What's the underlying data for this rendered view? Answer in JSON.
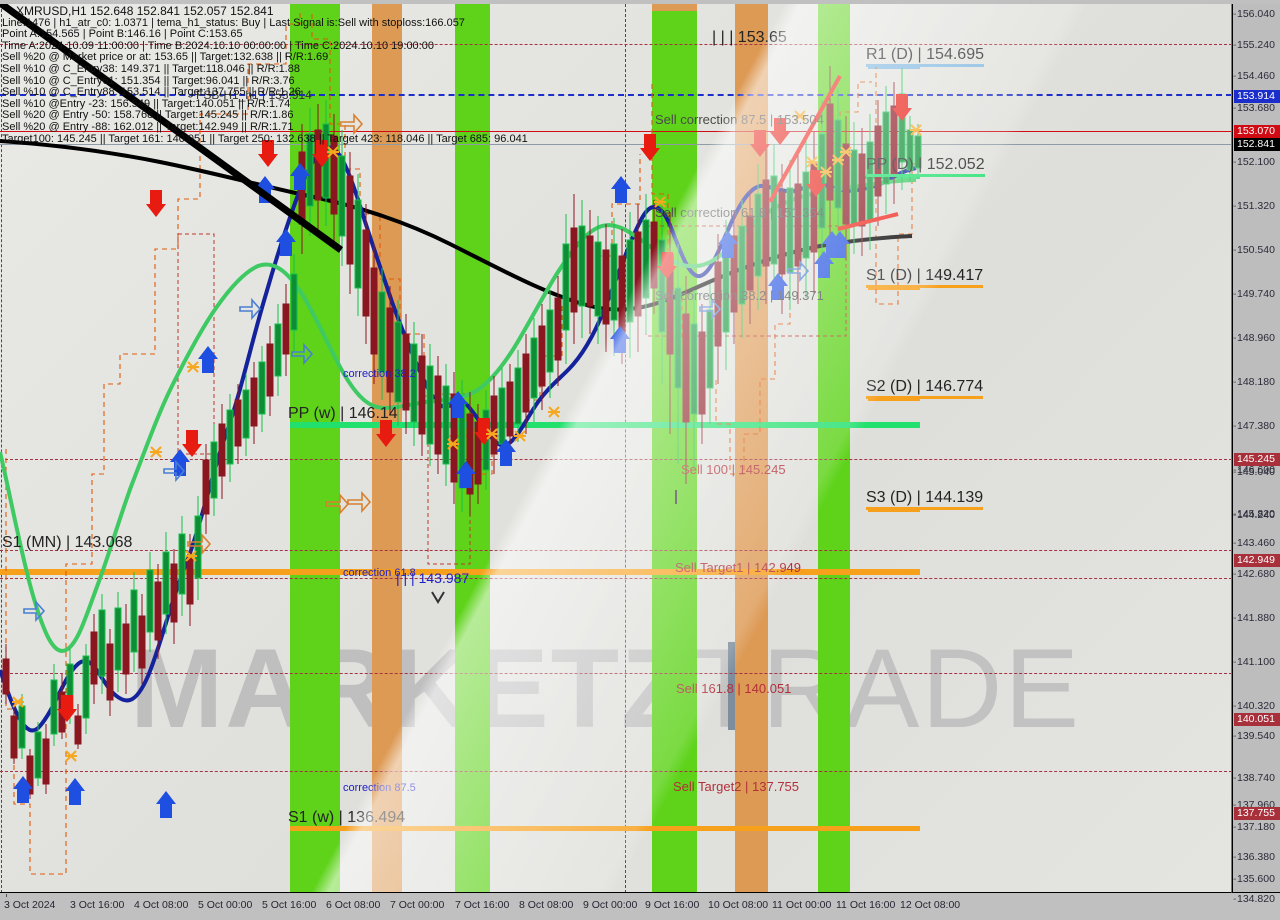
{
  "chart_data": {
    "type": "candlestick",
    "symbol": "XMRUSD",
    "timeframe": "H1",
    "ohlc_header": "152.648 152.841 152.057 152.841",
    "ylim": [
      134.6,
      156.3
    ],
    "ytick_labels": [
      "156.040",
      "155.240",
      "154.460",
      "153.680",
      "152.100",
      "151.320",
      "150.540",
      "149.740",
      "148.960",
      "148.180",
      "147.380",
      "146.600",
      "145.820",
      "145.040",
      "144.240",
      "143.460",
      "142.680",
      "141.880",
      "141.100",
      "140.320",
      "139.540",
      "138.740",
      "137.960",
      "137.180",
      "136.380",
      "135.600",
      "134.820"
    ],
    "xtick_labels": [
      "3 Oct 2024",
      "3 Oct 16:00",
      "4 Oct 08:00",
      "5 Oct 00:00",
      "5 Oct 16:00",
      "6 Oct 08:00",
      "7 Oct 00:00",
      "7 Oct 16:00",
      "8 Oct 08:00",
      "9 Oct 00:00",
      "9 Oct 16:00",
      "10 Oct 08:00",
      "11 Oct 00:00",
      "11 Oct 16:00",
      "12 Oct 08:00"
    ],
    "price_tags": [
      {
        "value": "153.914",
        "style": "blue"
      },
      {
        "value": "153.070",
        "style": "red"
      },
      {
        "value": "152.841",
        "style": "black"
      },
      {
        "value": "145.245",
        "style": "darkred"
      },
      {
        "value": "142.949",
        "style": "darkred"
      },
      {
        "value": "140.051",
        "style": "darkred"
      },
      {
        "value": "137.755",
        "style": "darkred"
      }
    ]
  },
  "header": {
    "symbol_line": "XMRUSD,H1  152.648 152.841 152.057 152.841",
    "lines": [
      "Line:1476 | h1_atr_c0: 1.0371 | tema_h1_status: Buy | Last Signal is:Sell with stoploss:166.057",
      "Point A:154.565 |  Point B:146.16 |  Point C:153.65",
      "Time A:2024.10.09 11:00:00 |  Time B:2024.10.10 00:00:00 |  Time C:2024.10.10 19:00:00",
      "Sell %20 @ Market price or at: 153.65 ||  Target:132.638 ||  R/R:1.69",
      "Sell %10 @ C_Entry38: 149.371 ||  Target:118.046 ||  R/R:1.88",
      "Sell %10 @ C_Entry61: 151.354 ||  Target:96.041 ||  R/R:3.76",
      "Sell %10 @ C_Entry88: 153.514 ||  Target:137.755 ||  R/R:1.26",
      "Sell %10 @Entry -23: 156.549 ||  Target:140.051 ||  R/R:1.74",
      "Sell %20 @ Entry -50: 158.768 ||  Target:145.245 ||  R/R:1.86",
      "Sell %20 @ Entry -88: 162.012 ||  Target:142.949 ||  R/R:1.71",
      "Target100: 145.245 ||  Target 161: 140.051 ||  Target 250: 132.638 ||  Target 423: 118.046 ||  Target 685: 96.041"
    ]
  },
  "annotations": {
    "pivot_c": "| | | 153.65",
    "r1_d": "R1 (D) | 154.695",
    "sell_corr_875": "Sell correction 87.5 | 153.504",
    "sell_corr_618": "Sell correction 61.8 | 151.354",
    "sell_corr_382": "Sell correction 38.2 | 149.371",
    "pp_d": "PP (D) | 152.052",
    "s1_d": "S1 (D) | 149.417",
    "s2_d": "S2 (D) | 146.774",
    "s3_d": "S3 (D) | 144.139",
    "pp_w": "PP (w) | 146.14",
    "s1_mn": "S1 (MN) | 143.068",
    "s1_w": "S1 (w) | 136.494",
    "corr_382": "correction 38.2",
    "corr_618": "correction 61.8",
    "corr_875": "correction 87.5",
    "fib_mid": "| | | 143.987",
    "sell_100": "Sell 100 | 145.245",
    "sell_target1": "Sell Target1 | 142.949",
    "sell_1618": "Sell 161.8 | 140.051",
    "sell_target2": "Sell Target2 | 137.755",
    "fsb_label": "FSB-H1_h1 | 153.914"
  },
  "watermark": {
    "bold": "MARKETZ",
    "thin": "TRADE"
  },
  "colors": {
    "band_green": "#5ed31a",
    "band_orange": "#dd9a55",
    "pivot_orange": "#f7a01c",
    "pp_green": "#22e06e",
    "bull_candle": "#14c24a",
    "bear_candle": "#8a1620",
    "ma_black": "#000000",
    "ma_navy": "#14229b",
    "ma_green": "#3ec963",
    "fractal_red": "#d10b14",
    "fractal_blue": "#1b2ecb",
    "price_tag_blue": "#1b2ecb",
    "price_tag_red": "#d10b14",
    "price_tag_dark_red": "#a8303b"
  }
}
